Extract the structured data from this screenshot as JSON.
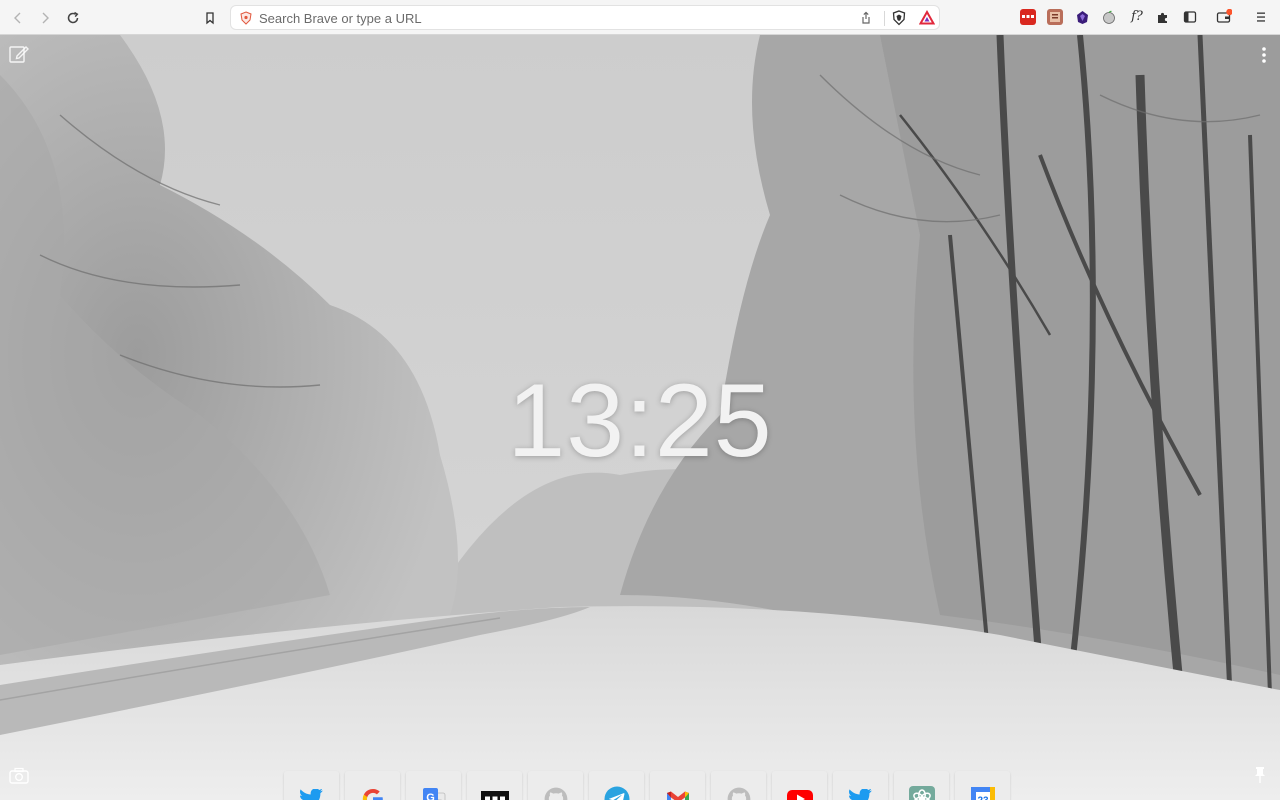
{
  "browser": {
    "url_placeholder": "Search Brave or type a URL"
  },
  "toolbar": {
    "buttons": [
      "back-icon",
      "forward-icon",
      "reload-icon",
      "bookmark-icon"
    ],
    "extensions": [
      "raindrop-icon",
      "reader-icon",
      "obsidian-icon",
      "apple-icon",
      "formula-icon",
      "puzzle-icon",
      "sidebar-icon",
      "wallet-icon",
      "menu-icon"
    ]
  },
  "ntp": {
    "clock": "13:25",
    "top_sites": [
      {
        "name": "Twitter",
        "icon": "twitter-icon"
      },
      {
        "name": "Google",
        "icon": "google-icon"
      },
      {
        "name": "Google Translate",
        "icon": "google-translate-icon"
      },
      {
        "name": "Site",
        "icon": "dots-icon"
      },
      {
        "name": "GitHub",
        "icon": "github-icon"
      },
      {
        "name": "Telegram",
        "icon": "telegram-icon"
      },
      {
        "name": "Gmail",
        "icon": "gmail-icon"
      },
      {
        "name": "GitHub",
        "icon": "github-icon"
      },
      {
        "name": "YouTube",
        "icon": "youtube-icon"
      },
      {
        "name": "Twitter",
        "icon": "twitter-icon"
      },
      {
        "name": "ChatGPT",
        "icon": "chatgpt-icon"
      },
      {
        "name": "Google Calendar",
        "icon": "google-calendar-icon",
        "label": "23"
      }
    ]
  },
  "colors": {
    "accent_brave": "#fb542b",
    "twitter": "#1d9bf0",
    "youtube": "#ff0000",
    "telegram": "#2aa3e0"
  }
}
